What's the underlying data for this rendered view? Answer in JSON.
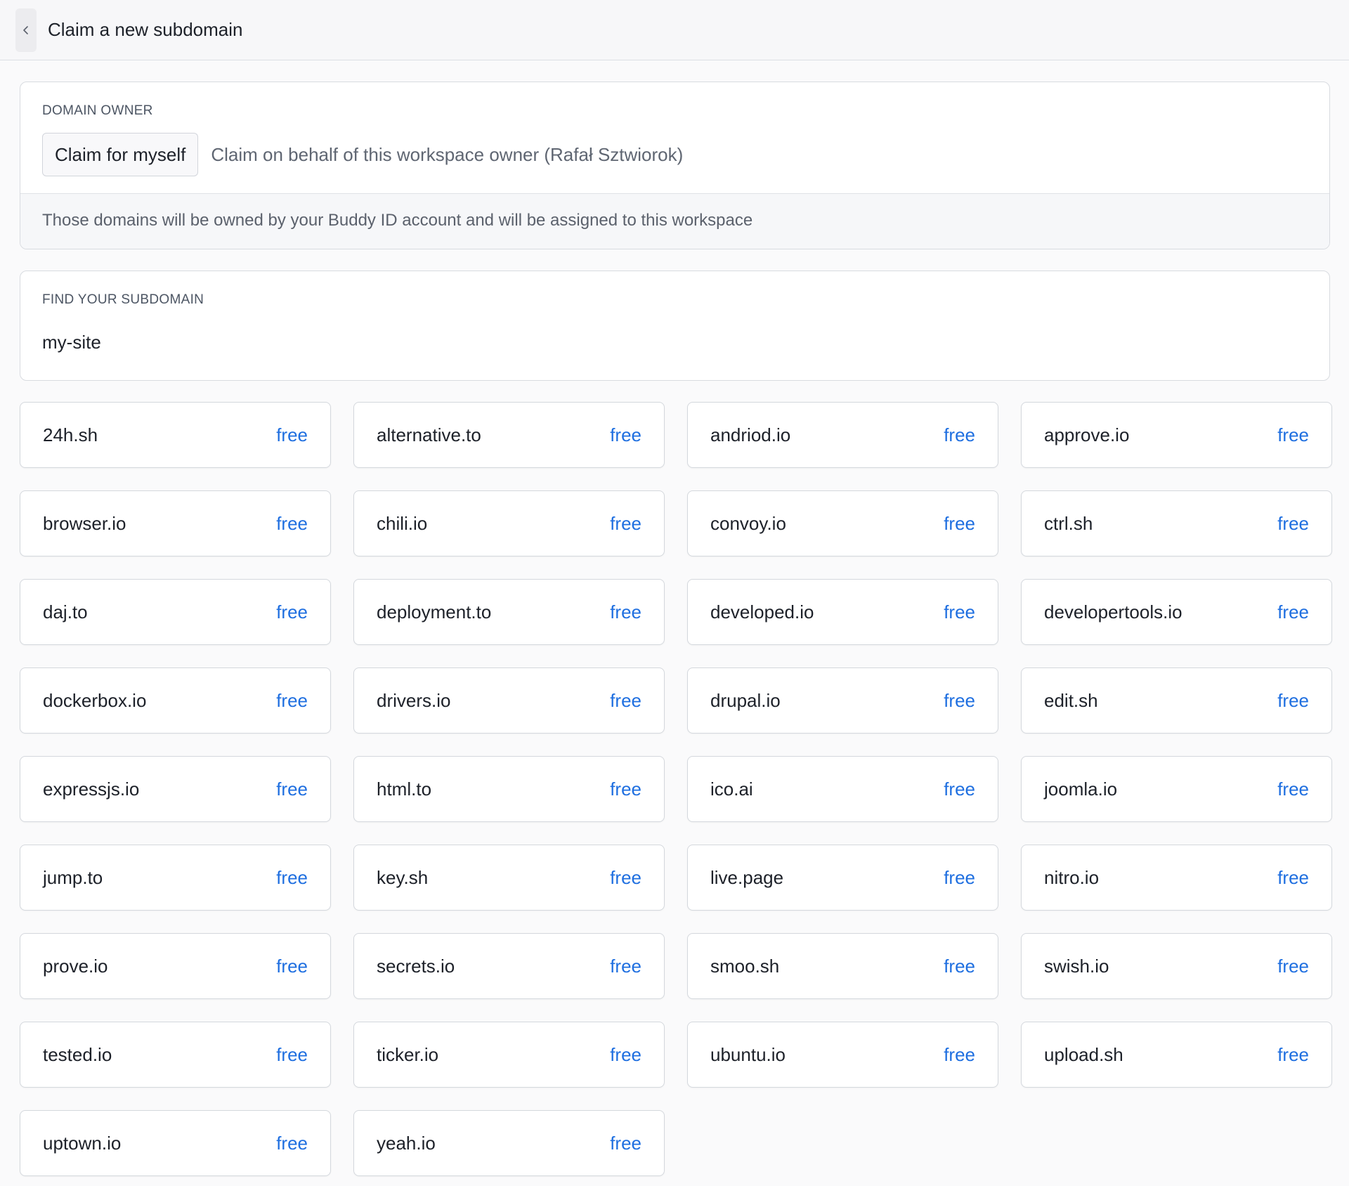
{
  "header": {
    "back_icon": "chevron-left-icon",
    "title": "Claim a new subdomain"
  },
  "owner": {
    "label": "DOMAIN OWNER",
    "selected_option": "Claim for myself",
    "alt_option": "Claim on behalf of this workspace owner (Rafał Sztwiorok)",
    "footer_note": "Those domains will be owned by your Buddy ID account and will be assigned to this workspace"
  },
  "search": {
    "label": "FIND YOUR SUBDOMAIN",
    "value": "my-site"
  },
  "colors": {
    "accent": "#1f6fe0"
  },
  "domains": [
    {
      "name": "24h.sh",
      "status": "free"
    },
    {
      "name": "alternative.to",
      "status": "free"
    },
    {
      "name": "andriod.io",
      "status": "free"
    },
    {
      "name": "approve.io",
      "status": "free"
    },
    {
      "name": "browser.io",
      "status": "free"
    },
    {
      "name": "chili.io",
      "status": "free"
    },
    {
      "name": "convoy.io",
      "status": "free"
    },
    {
      "name": "ctrl.sh",
      "status": "free"
    },
    {
      "name": "daj.to",
      "status": "free"
    },
    {
      "name": "deployment.to",
      "status": "free"
    },
    {
      "name": "developed.io",
      "status": "free"
    },
    {
      "name": "developertools.io",
      "status": "free"
    },
    {
      "name": "dockerbox.io",
      "status": "free"
    },
    {
      "name": "drivers.io",
      "status": "free"
    },
    {
      "name": "drupal.io",
      "status": "free"
    },
    {
      "name": "edit.sh",
      "status": "free"
    },
    {
      "name": "expressjs.io",
      "status": "free"
    },
    {
      "name": "html.to",
      "status": "free"
    },
    {
      "name": "ico.ai",
      "status": "free"
    },
    {
      "name": "joomla.io",
      "status": "free"
    },
    {
      "name": "jump.to",
      "status": "free"
    },
    {
      "name": "key.sh",
      "status": "free"
    },
    {
      "name": "live.page",
      "status": "free"
    },
    {
      "name": "nitro.io",
      "status": "free"
    },
    {
      "name": "prove.io",
      "status": "free"
    },
    {
      "name": "secrets.io",
      "status": "free"
    },
    {
      "name": "smoo.sh",
      "status": "free"
    },
    {
      "name": "swish.io",
      "status": "free"
    },
    {
      "name": "tested.io",
      "status": "free"
    },
    {
      "name": "ticker.io",
      "status": "free"
    },
    {
      "name": "ubuntu.io",
      "status": "free"
    },
    {
      "name": "upload.sh",
      "status": "free"
    },
    {
      "name": "uptown.io",
      "status": "free"
    },
    {
      "name": "yeah.io",
      "status": "free"
    }
  ]
}
